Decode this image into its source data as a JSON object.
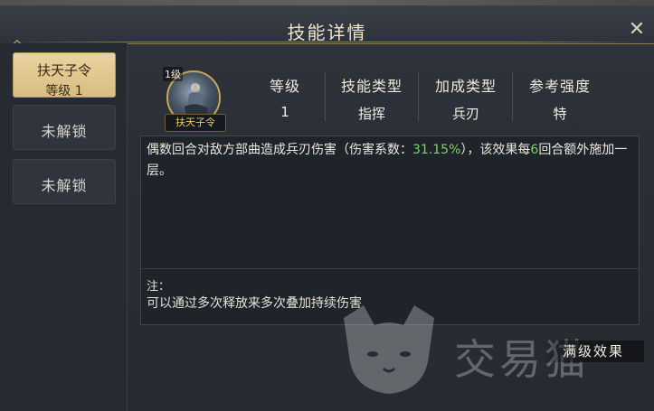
{
  "window": {
    "title": "技能详情",
    "close_icon": "close-x"
  },
  "tabs": [
    {
      "title": "扶天子令",
      "sub": "等级 1",
      "state": "active"
    },
    {
      "title": "未解锁",
      "state": "locked"
    },
    {
      "title": "未解锁",
      "state": "locked"
    }
  ],
  "skill": {
    "level_badge": "1级",
    "name": "扶天子令",
    "icon": "general-on-horse-portrait"
  },
  "stats": [
    {
      "label": "等级",
      "value": "1"
    },
    {
      "label": "技能类型",
      "value": "指挥"
    },
    {
      "label": "加成类型",
      "value": "兵刃"
    },
    {
      "label": "参考强度",
      "value": "特"
    }
  ],
  "description": {
    "part1": "偶数回合对敌方部曲造成兵刃伤害（伤害系数：",
    "coef": "31.15%",
    "part2": "），该效果每",
    "rounds": "6",
    "part3": "回合额外施加一层。",
    "note_label": "注：",
    "note_text": "可以通过多次释放来多次叠加持续伤害"
  },
  "max_effect_button": "满级效果",
  "watermark": "交易猫",
  "colors": {
    "accent_gold": "#d9bd81",
    "highlight_green": "#7dd36b",
    "name_gold": "#f0c560"
  }
}
